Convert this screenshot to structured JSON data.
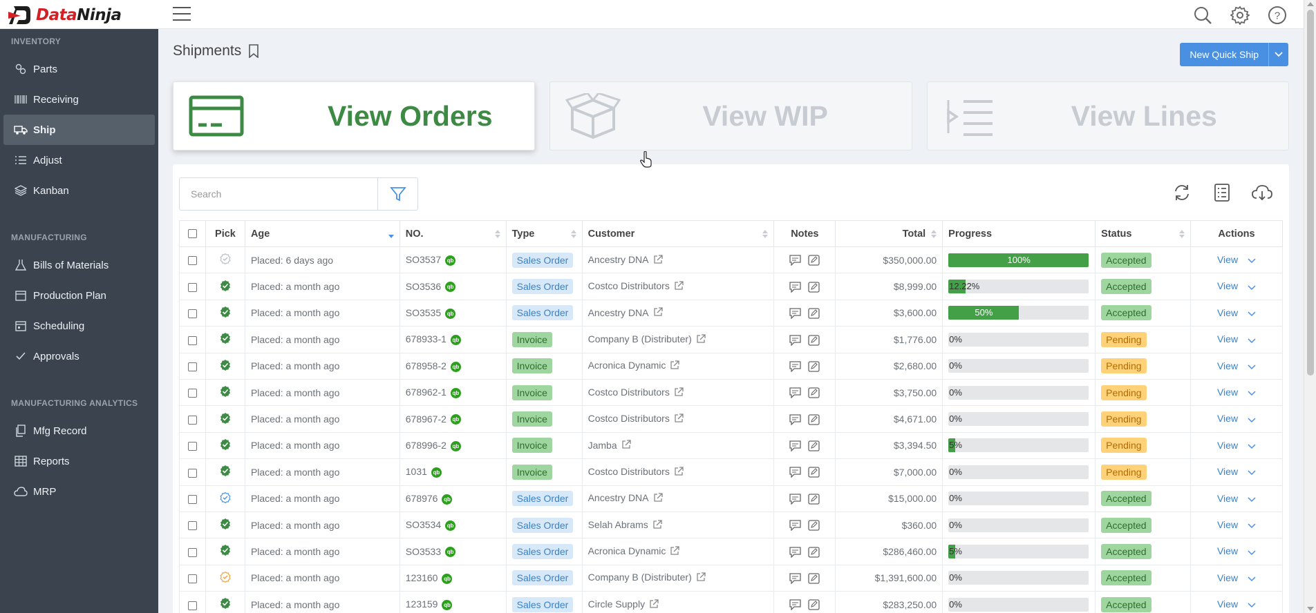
{
  "app": {
    "logo_text_1": "Data",
    "logo_text_2": "Ninja"
  },
  "sidebar": {
    "sections": [
      {
        "label": "INVENTORY",
        "items": [
          {
            "label": "Parts",
            "icon": "gears-icon"
          },
          {
            "label": "Receiving",
            "icon": "barcode-icon"
          },
          {
            "label": "Ship",
            "icon": "truck-icon",
            "active": true
          },
          {
            "label": "Adjust",
            "icon": "list-adjust-icon"
          },
          {
            "label": "Kanban",
            "icon": "layers-icon"
          }
        ]
      },
      {
        "label": "MANUFACTURING",
        "items": [
          {
            "label": "Bills of Materials",
            "icon": "flask-icon"
          },
          {
            "label": "Production Plan",
            "icon": "calendar-icon"
          },
          {
            "label": "Scheduling",
            "icon": "calendar-check-icon"
          },
          {
            "label": "Approvals",
            "icon": "checkmark-icon"
          }
        ]
      },
      {
        "label": "MANUFACTURING ANALYTICS",
        "items": [
          {
            "label": "Mfg Record",
            "icon": "copy-icon"
          },
          {
            "label": "Reports",
            "icon": "table-icon"
          },
          {
            "label": "MRP",
            "icon": "cloud-icon"
          }
        ]
      }
    ]
  },
  "page": {
    "title": "Shipments",
    "new_quick_ship": "New Quick Ship"
  },
  "cards": {
    "orders": "View Orders",
    "wip": "View WIP",
    "lines": "View Lines"
  },
  "search": {
    "placeholder": "Search"
  },
  "table": {
    "headers": {
      "pick": "Pick",
      "age": "Age",
      "no": "NO.",
      "type": "Type",
      "customer": "Customer",
      "notes": "Notes",
      "total": "Total",
      "progress": "Progress",
      "status": "Status",
      "actions": "Actions"
    },
    "view_label": "View",
    "rows": [
      {
        "pick": "gray",
        "age": "Placed: 6 days ago",
        "no": "SO3537",
        "type": "Sales Order",
        "customer": "Ancestry DNA",
        "total": "$350,000.00",
        "progress": 100,
        "progress_label": "100%",
        "status": "Accepted"
      },
      {
        "pick": "green",
        "age": "Placed: a month ago",
        "no": "SO3536",
        "type": "Sales Order",
        "customer": "Costco Distributors",
        "total": "$8,999.00",
        "progress": 12.22,
        "progress_label": "12.22%",
        "status": "Accepted"
      },
      {
        "pick": "green",
        "age": "Placed: a month ago",
        "no": "SO3535",
        "type": "Sales Order",
        "customer": "Ancestry DNA",
        "total": "$3,600.00",
        "progress": 50,
        "progress_label": "50%",
        "status": "Accepted"
      },
      {
        "pick": "green",
        "age": "Placed: a month ago",
        "no": "678933-1",
        "type": "Invoice",
        "customer": "Company B (Distributer)",
        "total": "$1,776.00",
        "progress": 0,
        "progress_label": "0%",
        "status": "Pending"
      },
      {
        "pick": "green",
        "age": "Placed: a month ago",
        "no": "678958-2",
        "type": "Invoice",
        "customer": "Acronica Dynamic",
        "total": "$2,680.00",
        "progress": 0,
        "progress_label": "0%",
        "status": "Pending"
      },
      {
        "pick": "green",
        "age": "Placed: a month ago",
        "no": "678962-1",
        "type": "Invoice",
        "customer": "Costco Distributors",
        "total": "$3,750.00",
        "progress": 0,
        "progress_label": "0%",
        "status": "Pending"
      },
      {
        "pick": "green",
        "age": "Placed: a month ago",
        "no": "678967-2",
        "type": "Invoice",
        "customer": "Costco Distributors",
        "total": "$4,671.00",
        "progress": 0,
        "progress_label": "0%",
        "status": "Pending"
      },
      {
        "pick": "green",
        "age": "Placed: a month ago",
        "no": "678996-2",
        "type": "Invoice",
        "customer": "Jamba",
        "total": "$3,394.50",
        "progress": 5,
        "progress_label": "5%",
        "status": "Pending"
      },
      {
        "pick": "green",
        "age": "Placed: a month ago",
        "no": "1031",
        "type": "Invoice",
        "customer": "Costco Distributors",
        "total": "$7,000.00",
        "progress": 0,
        "progress_label": "0%",
        "status": "Pending"
      },
      {
        "pick": "blue",
        "age": "Placed: a month ago",
        "no": "678976",
        "type": "Sales Order",
        "customer": "Ancestry DNA",
        "total": "$15,000.00",
        "progress": 0,
        "progress_label": "0%",
        "status": "Accepted"
      },
      {
        "pick": "green",
        "age": "Placed: a month ago",
        "no": "SO3534",
        "type": "Sales Order",
        "customer": "Selah Abrams",
        "total": "$360.00",
        "progress": 0,
        "progress_label": "0%",
        "status": "Accepted"
      },
      {
        "pick": "green",
        "age": "Placed: a month ago",
        "no": "SO3533",
        "type": "Sales Order",
        "customer": "Acronica Dynamic",
        "total": "$286,460.00",
        "progress": 5,
        "progress_label": "5%",
        "status": "Accepted"
      },
      {
        "pick": "orange",
        "age": "Placed: a month ago",
        "no": "123160",
        "type": "Sales Order",
        "customer": "Company B (Distributer)",
        "total": "$1,391,600.00",
        "progress": 0,
        "progress_label": "0%",
        "status": "Accepted"
      },
      {
        "pick": "green",
        "age": "Placed: a month ago",
        "no": "123159",
        "type": "Sales Order",
        "customer": "Circle Supply",
        "total": "$283,250.00",
        "progress": 0,
        "progress_label": "0%",
        "status": "Accepted"
      }
    ]
  },
  "colors": {
    "accent": "#4a90e2",
    "sidebar_bg": "#3a434e",
    "green": "#3c8a43",
    "pending": "#ffd27a"
  }
}
